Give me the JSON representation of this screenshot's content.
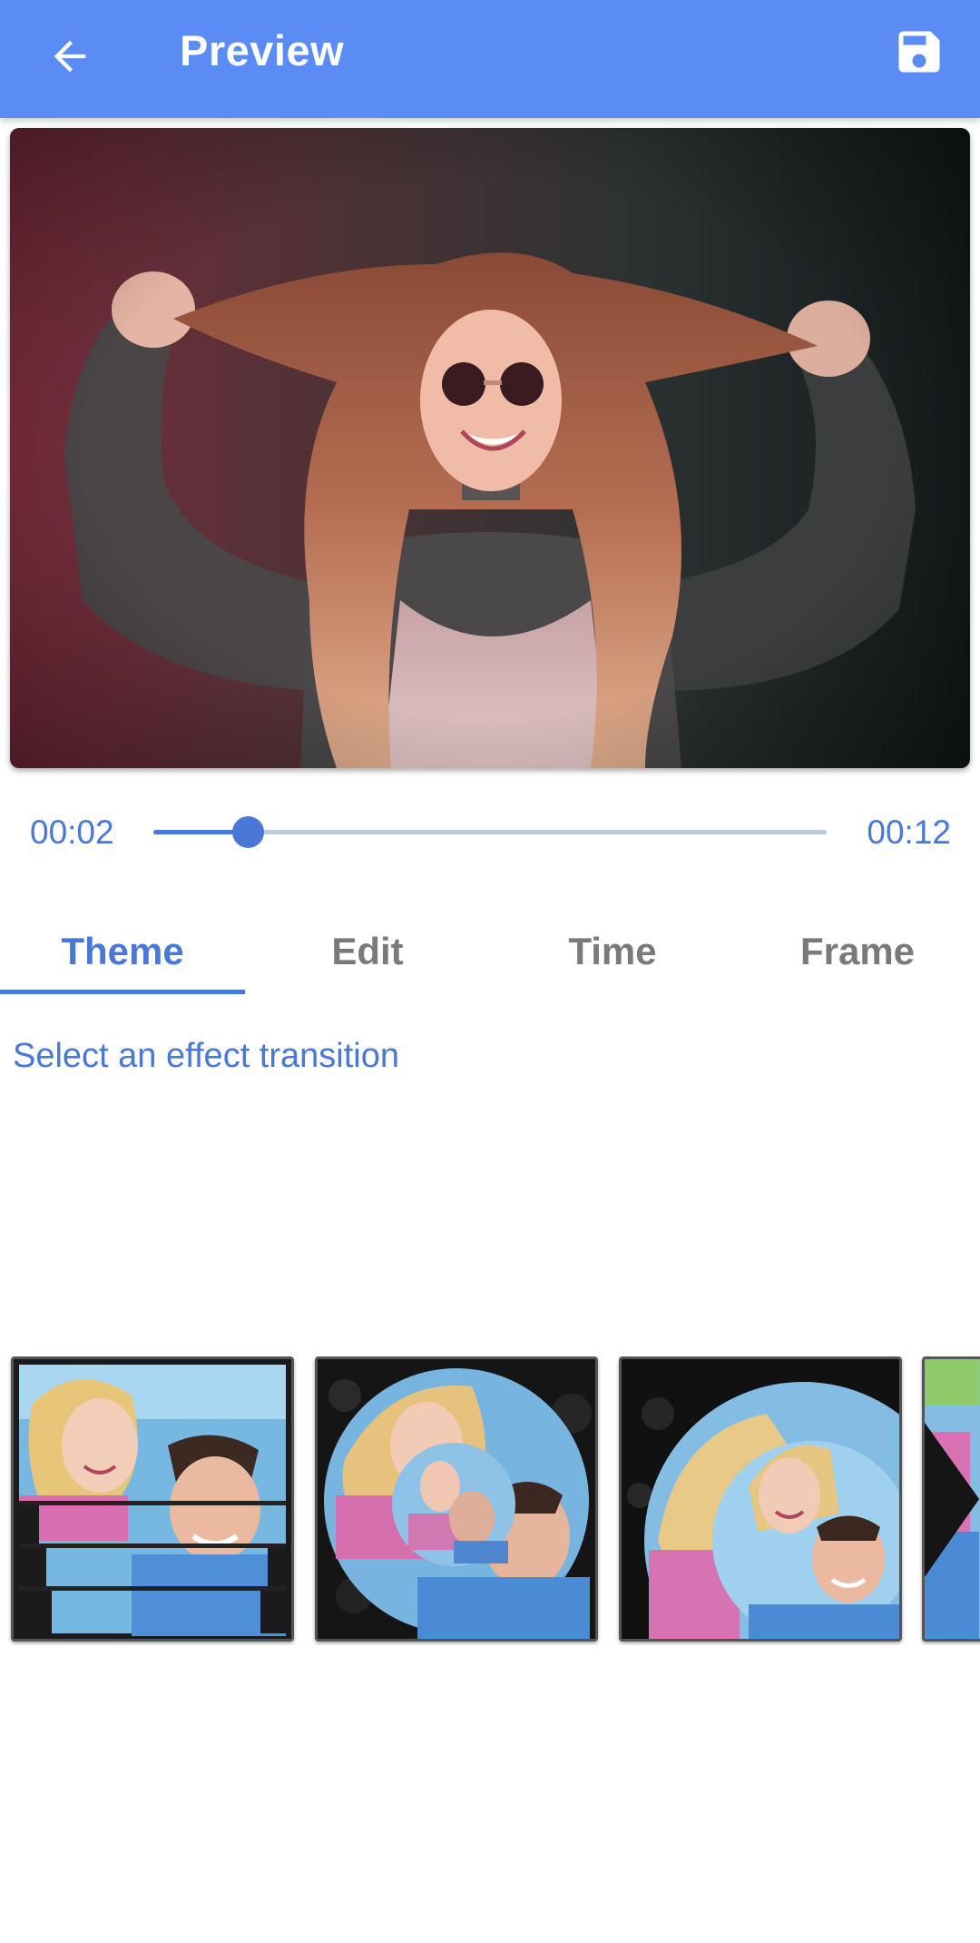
{
  "appbar": {
    "title": "Preview",
    "back_icon": "arrow-back-icon",
    "save_icon": "save-floppy-icon",
    "color": "#5b8cf5"
  },
  "player": {
    "current_time": "00:02",
    "total_time": "00:12",
    "progress": 0.14,
    "accent_color": "#4a78d6"
  },
  "tabs": [
    {
      "label": "Theme",
      "active": true
    },
    {
      "label": "Edit",
      "active": false
    },
    {
      "label": "Time",
      "active": false
    },
    {
      "label": "Frame",
      "active": false
    }
  ],
  "theme": {
    "hint": "Select an effect transition",
    "effects": [
      "strips-transition",
      "circle-zoom-transition",
      "circle-reveal-transition",
      "wedge-transition"
    ]
  }
}
